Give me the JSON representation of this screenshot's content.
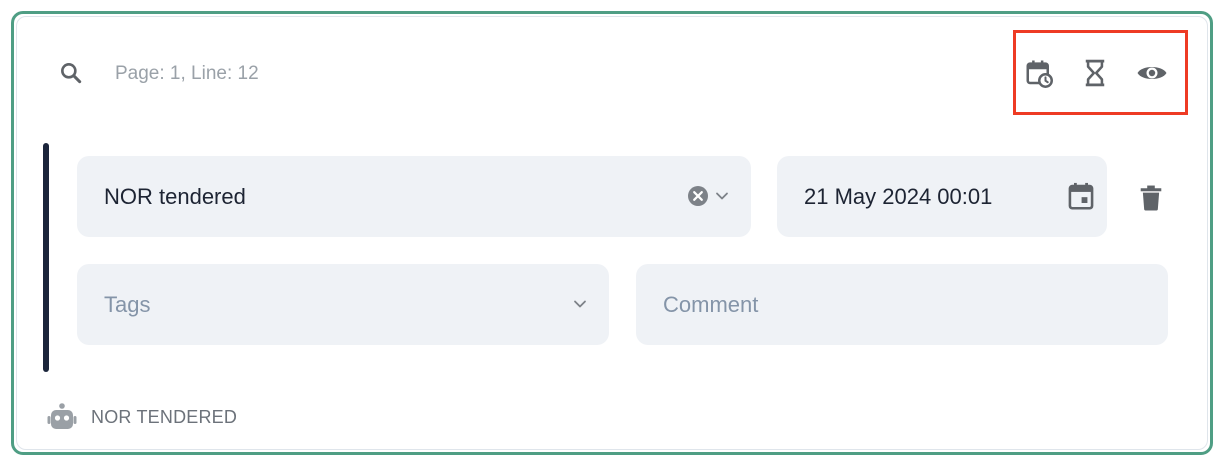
{
  "header": {
    "search_icon": "search-icon",
    "location_text": "Page: 1, Line: 12"
  },
  "toolbar": {
    "buttons": [
      {
        "icon": "calendar-clock-icon"
      },
      {
        "icon": "hourglass-icon"
      },
      {
        "icon": "eye-icon"
      }
    ],
    "highlight_color": "#ee3b24"
  },
  "event": {
    "selected_value": "NOR tendered",
    "date_value": "21 May 2024 00:01"
  },
  "tags": {
    "placeholder": "Tags"
  },
  "comment": {
    "placeholder": "Comment"
  },
  "footer": {
    "icon": "robot-icon",
    "label": "NOR TENDERED"
  },
  "colors": {
    "card_border": "#4f9e84",
    "field_bg": "#eff2f6",
    "left_bar": "#1b253b",
    "icon_gray": "#6e7378"
  }
}
